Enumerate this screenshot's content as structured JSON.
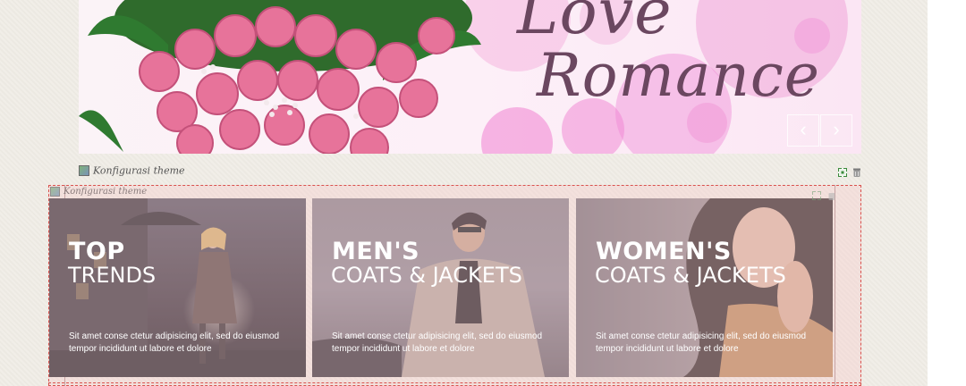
{
  "slider": {
    "title_line1": "Love",
    "title_line2": "Romance",
    "prev_label": "‹",
    "next_label": "›"
  },
  "config_bar": {
    "label": "Konfigurasi theme"
  },
  "module": {
    "label": "Konfigurasi theme"
  },
  "banners": [
    {
      "title": "TOP",
      "subtitle": "TRENDS",
      "description": "Sit amet conse ctetur adipisicing elit, sed do eiusmod tempor incididunt ut labore et dolore"
    },
    {
      "title": "MEN'S",
      "subtitle": "COATS & JACKETS",
      "description": "Sit amet conse ctetur adipisicing elit, sed do eiusmod tempor incididunt ut labore et dolore"
    },
    {
      "title": "WOMEN'S",
      "subtitle": "COATS & JACKETS",
      "description": "Sit amet conse ctetur adipisicing elit, sed do eiusmod tempor incididunt ut labore et dolore"
    }
  ],
  "colors": {
    "accent_border": "#d9534f",
    "slide_title": "#6b4760"
  },
  "icons": [
    "config-icon",
    "expand-icon",
    "trash-icon",
    "chevron-left-icon",
    "chevron-right-icon"
  ]
}
